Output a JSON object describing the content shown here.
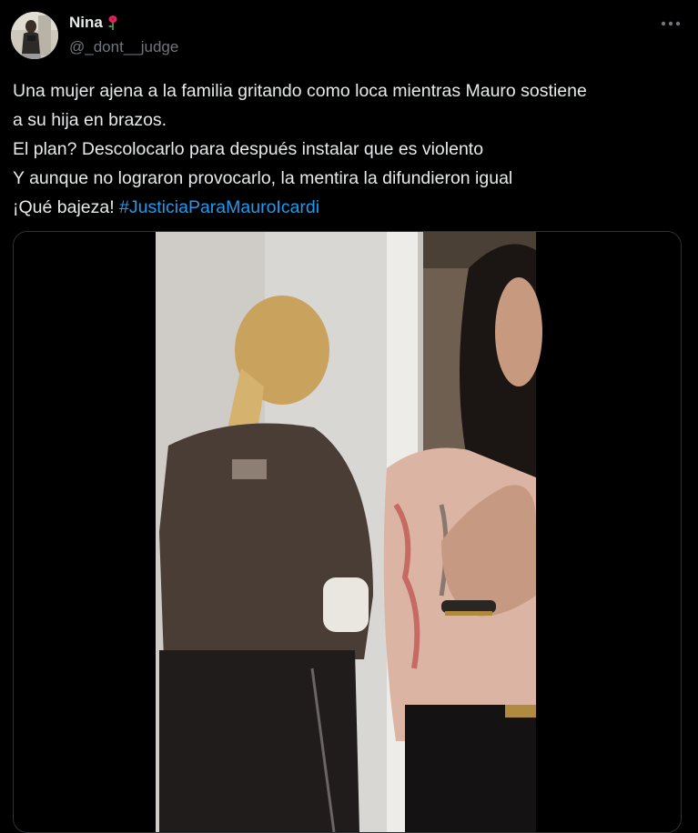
{
  "author": {
    "display_name": "Nina",
    "handle": "@_dont__judge",
    "name_emoji": "rose-icon"
  },
  "tweet": {
    "lines": [
      "Una mujer ajena a la familia gritando como loca mientras Mauro sostiene",
      "a su hija en brazos.",
      "El plan? Descolocarlo para después instalar que es violento",
      "Y aunque no lograron provocarlo, la mentira la difundieron igual",
      "¡Qué bajeza! "
    ],
    "hashtag": "#JusticiaParaMauroIcardi"
  },
  "icons": {
    "more": "more-dots-icon",
    "avatar": "profile-photo"
  },
  "colors": {
    "background": "#000000",
    "text_primary": "#e7e9ea",
    "text_secondary": "#71767b",
    "link": "#1d9bf0",
    "border": "#2f3336"
  }
}
